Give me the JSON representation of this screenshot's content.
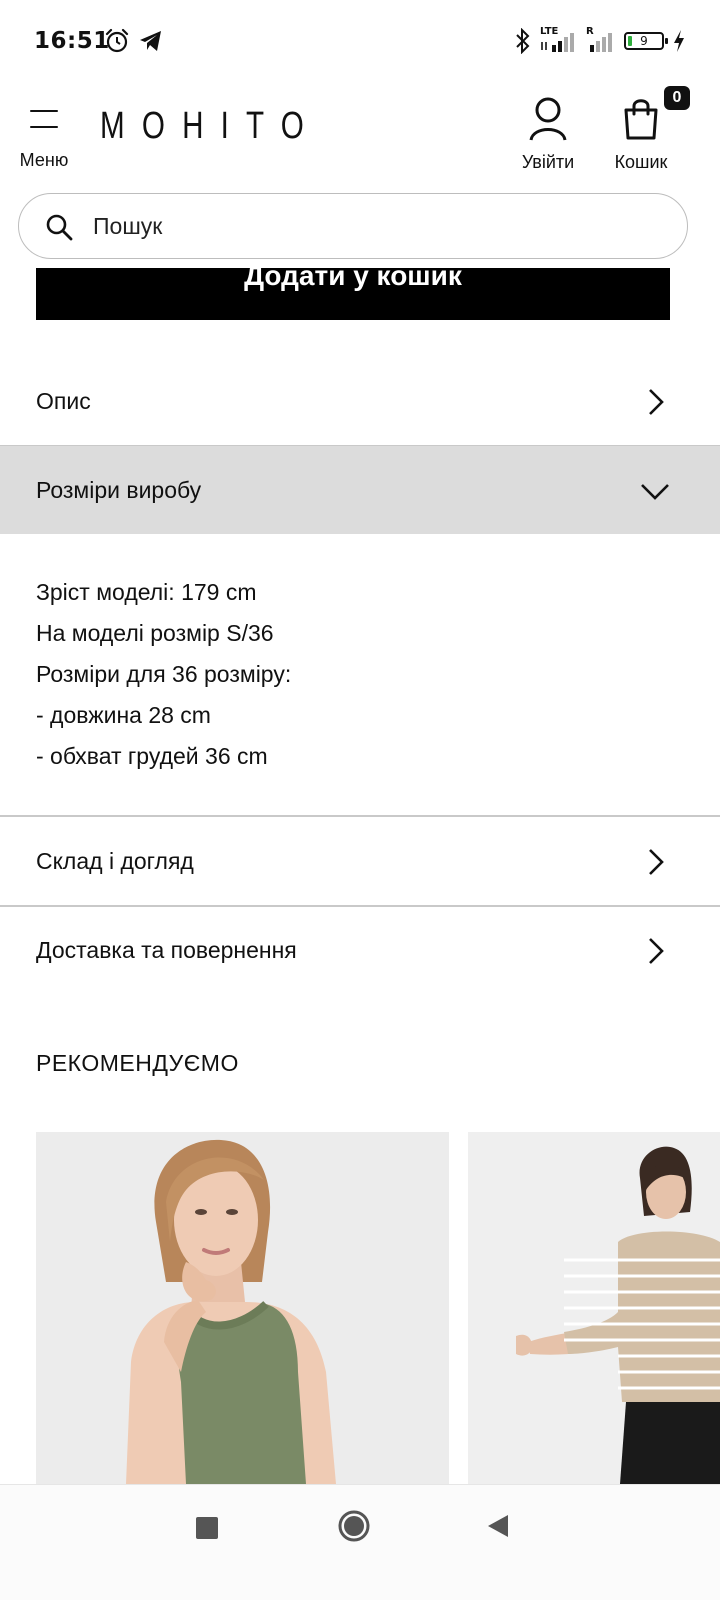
{
  "status_bar": {
    "time": "16:51",
    "network_label_1": "LTE",
    "network_label_2": "R",
    "battery_level": "9",
    "icons": [
      "alarm-icon",
      "telegram-icon",
      "bluetooth-icon",
      "signal-icon",
      "signal-icon",
      "battery-icon",
      "charging-icon"
    ]
  },
  "header": {
    "menu_label": "Меню",
    "logo_text": "MOHITO",
    "login_label": "Увійти",
    "cart_label": "Кошик",
    "cart_count": "0"
  },
  "search": {
    "placeholder": "Пошук"
  },
  "product": {
    "add_to_cart_label": "Додати у кошик"
  },
  "accordion": {
    "description_label": "Опис",
    "sizes_label": "Розміри виробу",
    "sizes_lines": [
      "Зріст моделі: 179 cm",
      "На моделі розмір S/36",
      "Розміри для 36 розміру:",
      "- довжина 28 cm",
      "- обхват грудей 36 cm"
    ],
    "composition_label": "Склад і догляд",
    "delivery_label": "Доставка та повернення"
  },
  "recommendations": {
    "title": "РЕКОМЕНДУЄМО"
  },
  "colors": {
    "accent": "#000000",
    "open_row_bg": "#dcdcdc",
    "divider": "#c9c9c9"
  }
}
